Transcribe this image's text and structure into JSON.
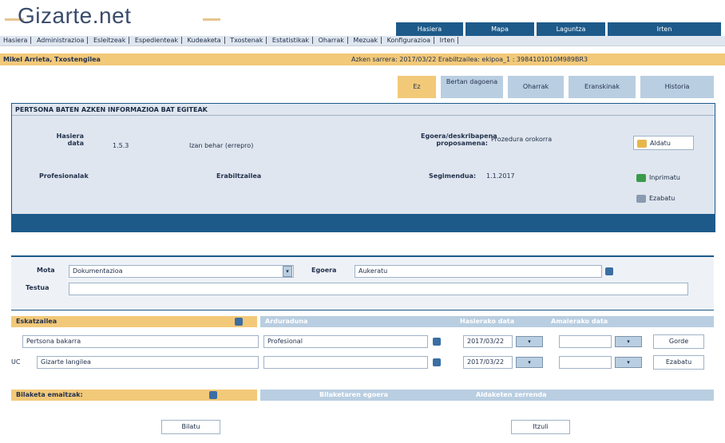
{
  "logo": "Gizarte.net",
  "topnav": [
    "Hasiera",
    "Mapa",
    "Laguntza",
    "Irten"
  ],
  "menubar": [
    "Hasiera",
    "Administrazioa",
    "Esleitzeak",
    "Espedienteak",
    "Kudeaketa",
    "Txostenak",
    "Estatistikak",
    "Oharrak",
    "Mezuak",
    "Konfigurazioa",
    "Irten"
  ],
  "userbar": {
    "user": "Mikel Arrieta, Txostengilea",
    "session": "Azken sarrera: 2017/03/22 Erabiltzailea: ekipoa_1 : 3984101010M989BR3"
  },
  "tabs": [
    "Ez",
    "Bertan dagoena",
    "Oharrak",
    "Eranskinak",
    "Historia"
  ],
  "panel": {
    "title": "PERTSONA BATEN AZKEN INFORMAZIOA BAT EGITEAK",
    "fields": {
      "date_label": "Hasiera data",
      "date_value": "1.5.3",
      "type_label": "Izan behar (errepro)",
      "status_label": "Egoera/deskribapena proposamena:",
      "status_value": "Prozedura orokorra",
      "professional_label": "Profesionalak",
      "professional_value": "Erabiltzailea",
      "follow_label": "Segimendua:",
      "follow_value": "1.1.2017"
    },
    "buttons": [
      "Aldatu",
      "Inprimatu",
      "Ezabatu"
    ]
  },
  "search": {
    "mota_label": "Mota",
    "mota_value": "Dokumentazioa",
    "estatus_label": "Egoera",
    "estatus_value": "Aukeratu",
    "testua_label": "Testua",
    "testua_value": ""
  },
  "table": {
    "headers": [
      "Eskatzailea",
      "Arduraduna",
      "Hasierako data",
      "Amaierako data"
    ],
    "rows": [
      {
        "a": "Pertsona bakarra",
        "b": "Profesional",
        "c": "2017/03/22",
        "d": ""
      },
      {
        "a": "Gizarte langilea",
        "b": "",
        "c": "2017/03/22",
        "d": ""
      }
    ],
    "row_buttons": [
      "Gorde",
      "Ezabatu"
    ],
    "code_label": "UC"
  },
  "footer": {
    "label": "Bilaketa emaitzak:",
    "col1": "Bilaketaren egoera",
    "col2": "Aldaketen zerrenda",
    "buttons": [
      "Bilatu",
      "Itzuli"
    ]
  }
}
